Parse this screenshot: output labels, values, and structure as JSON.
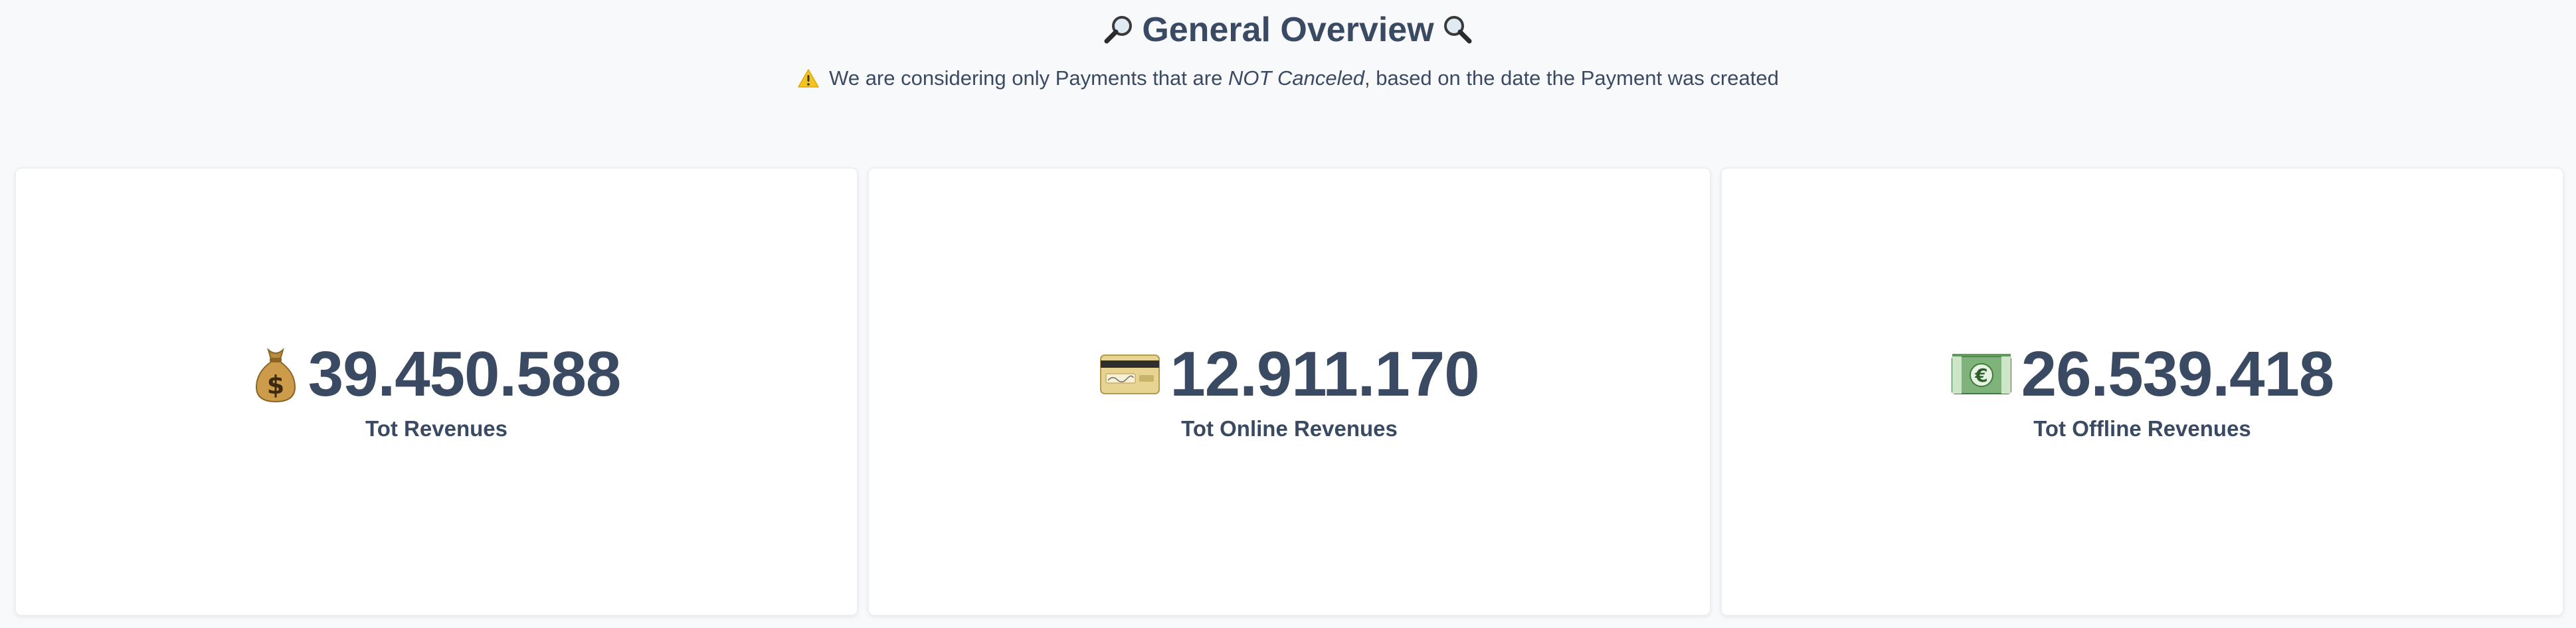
{
  "header": {
    "title": "General Overview",
    "left_icon": "magnifying-glass-left-icon",
    "right_icon": "magnifying-glass-right-icon",
    "warning_icon": "warning-icon",
    "subtitle_part1": "We are considering only Payments that are",
    "subtitle_emphasis": "NOT Canceled",
    "subtitle_part2": ", based on the date the Payment was created"
  },
  "cards": [
    {
      "icon": "money-bag-icon",
      "value": "39.450.588",
      "label": "Tot Revenues"
    },
    {
      "icon": "credit-card-icon",
      "value": "12.911.170",
      "label": "Tot Online Revenues"
    },
    {
      "icon": "euro-banknote-icon",
      "value": "26.539.418",
      "label": "Tot Offline Revenues"
    }
  ],
  "colors": {
    "background": "#f8f9fb",
    "card": "#ffffff",
    "text": "#3b4a63"
  }
}
